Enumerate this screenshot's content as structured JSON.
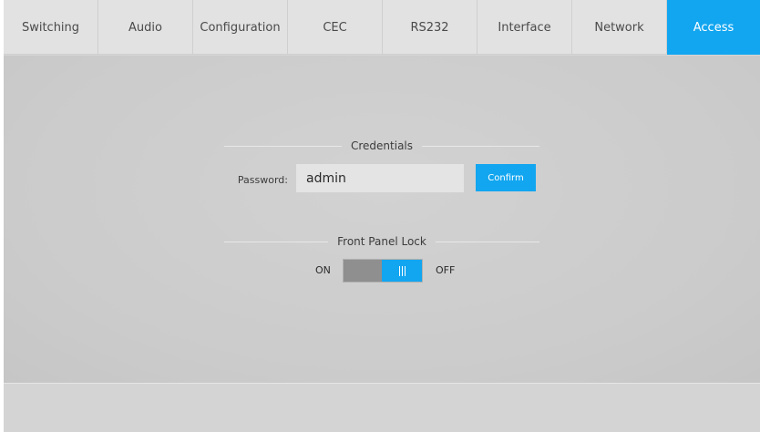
{
  "tabs": [
    {
      "label": "Switching",
      "active": false
    },
    {
      "label": "Audio",
      "active": false
    },
    {
      "label": "Configuration",
      "active": false
    },
    {
      "label": "CEC",
      "active": false
    },
    {
      "label": "RS232",
      "active": false
    },
    {
      "label": "Interface",
      "active": false
    },
    {
      "label": "Network",
      "active": false
    },
    {
      "label": "Access",
      "active": true
    }
  ],
  "credentials": {
    "title": "Credentials",
    "password_label": "Password:",
    "password_value": "admin",
    "confirm_label": "Confirm"
  },
  "front_panel_lock": {
    "title": "Front Panel Lock",
    "on_label": "ON",
    "off_label": "OFF",
    "state": "OFF"
  },
  "colors": {
    "accent": "#12a6f0",
    "background": "#d6d6d6",
    "tab_bar": "#e2e2e2"
  },
  "icons": {
    "toggle_knob": "grip-lines-icon"
  }
}
